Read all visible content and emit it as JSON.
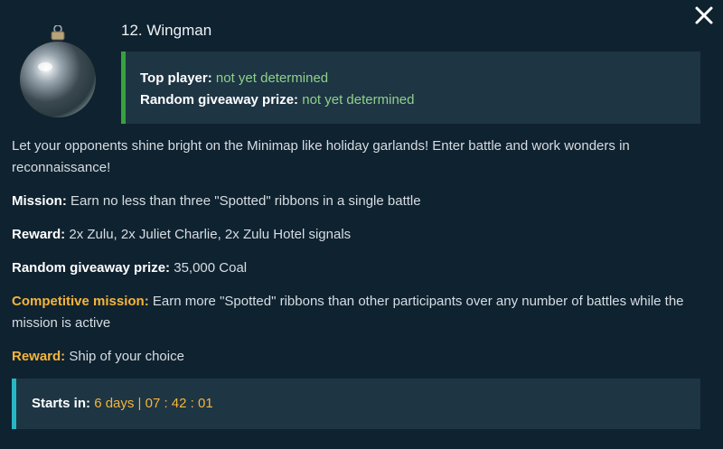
{
  "header": {
    "title": "12. Wingman"
  },
  "status": {
    "top_player_label": "Top player:",
    "top_player_value": "not yet determined",
    "giveaway_label": "Random giveaway prize:",
    "giveaway_value": "not yet determined"
  },
  "description": "Let your opponents shine bright on the Minimap like holiday garlands! Enter battle and work wonders in reconnaissance!",
  "mission": {
    "label": "Mission:",
    "text": "Earn no less than three \"Spotted\" ribbons in a single battle"
  },
  "reward": {
    "label": "Reward:",
    "text": "2x Zulu, 2x Juliet Charlie, 2x Zulu Hotel signals"
  },
  "giveaway_prize": {
    "label": "Random giveaway prize:",
    "text": "35,000 Coal"
  },
  "competitive_mission": {
    "label": "Competitive mission:",
    "text": "Earn more \"Spotted\" ribbons than other participants over any number of battles while the mission is active"
  },
  "competitive_reward": {
    "label": "Reward:",
    "text": "Ship of your choice"
  },
  "timer": {
    "label": "Starts in:",
    "value": "6 days | 07 : 42 : 01"
  },
  "colors": {
    "background": "#0f2230",
    "panel": "#1e3544",
    "green_accent": "#37a23c",
    "green_text": "#8fd18b",
    "gold": "#f5b53a",
    "cyan_accent": "#27b6c4"
  },
  "icons": {
    "close": "close-icon",
    "ornament": "ornament-icon"
  }
}
